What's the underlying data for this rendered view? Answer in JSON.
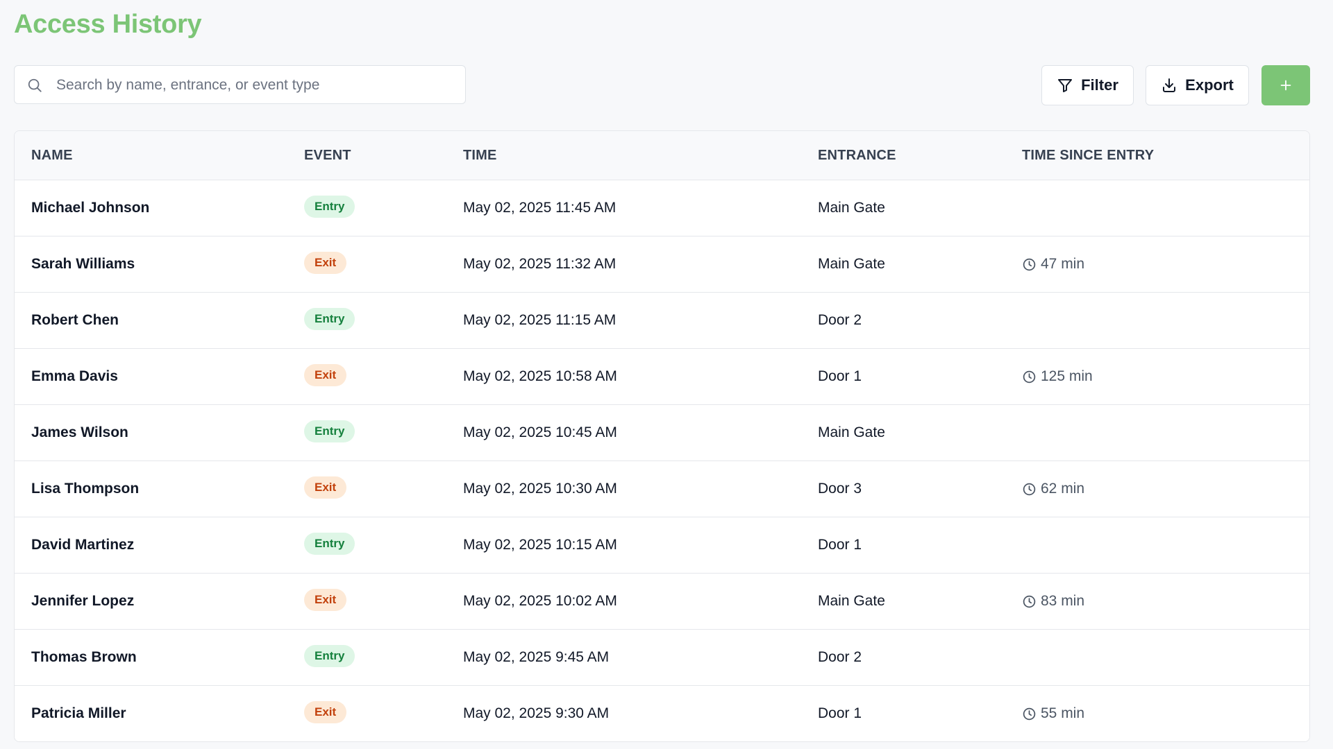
{
  "header": {
    "title": "Access History"
  },
  "search": {
    "placeholder": "Search by name, entrance, or event type",
    "value": ""
  },
  "toolbar": {
    "filter_label": "Filter",
    "export_label": "Export",
    "add_icon": "plus-icon"
  },
  "colors": {
    "accent": "#7cc576",
    "entry_bg": "#def6e6",
    "entry_text": "#15803d",
    "exit_bg": "#fde9d6",
    "exit_text": "#c2410c"
  },
  "table": {
    "columns": {
      "name": "NAME",
      "event": "EVENT",
      "time": "TIME",
      "entrance": "ENTRANCE",
      "since": "TIME SINCE ENTRY"
    },
    "rows": [
      {
        "name": "Michael Johnson",
        "event": "Entry",
        "time": "May 02, 2025 11:45 AM",
        "entrance": "Main Gate",
        "since": ""
      },
      {
        "name": "Sarah Williams",
        "event": "Exit",
        "time": "May 02, 2025 11:32 AM",
        "entrance": "Main Gate",
        "since": "47 min"
      },
      {
        "name": "Robert Chen",
        "event": "Entry",
        "time": "May 02, 2025 11:15 AM",
        "entrance": "Door 2",
        "since": ""
      },
      {
        "name": "Emma Davis",
        "event": "Exit",
        "time": "May 02, 2025 10:58 AM",
        "entrance": "Door 1",
        "since": "125 min"
      },
      {
        "name": "James Wilson",
        "event": "Entry",
        "time": "May 02, 2025 10:45 AM",
        "entrance": "Main Gate",
        "since": ""
      },
      {
        "name": "Lisa Thompson",
        "event": "Exit",
        "time": "May 02, 2025 10:30 AM",
        "entrance": "Door 3",
        "since": "62 min"
      },
      {
        "name": "David Martinez",
        "event": "Entry",
        "time": "May 02, 2025 10:15 AM",
        "entrance": "Door 1",
        "since": ""
      },
      {
        "name": "Jennifer Lopez",
        "event": "Exit",
        "time": "May 02, 2025 10:02 AM",
        "entrance": "Main Gate",
        "since": "83 min"
      },
      {
        "name": "Thomas Brown",
        "event": "Entry",
        "time": "May 02, 2025 9:45 AM",
        "entrance": "Door 2",
        "since": ""
      },
      {
        "name": "Patricia Miller",
        "event": "Exit",
        "time": "May 02, 2025 9:30 AM",
        "entrance": "Door 1",
        "since": "55 min"
      }
    ]
  }
}
